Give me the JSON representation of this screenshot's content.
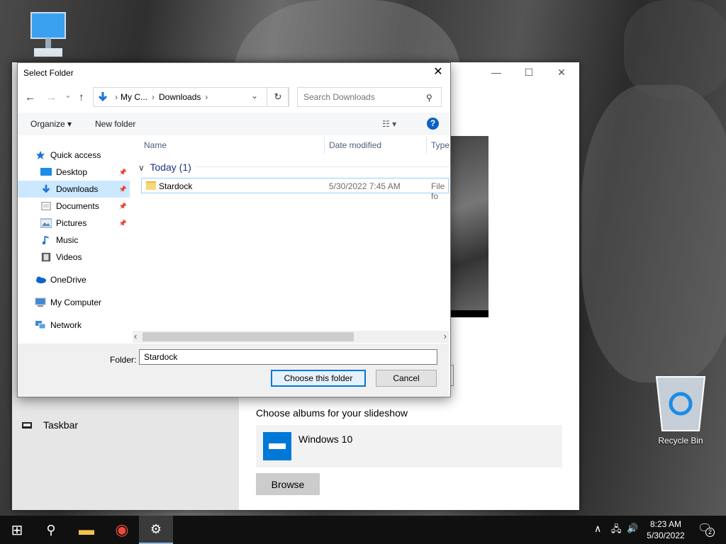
{
  "desktop": {
    "recycle_bin_label": "Recycle Bin"
  },
  "settings": {
    "minimize": "—",
    "maximize": "☐",
    "close": "✕",
    "taskbar_label": "Taskbar",
    "albums_heading": "Choose albums for your slideshow",
    "album_name": "Windows 10",
    "browse_label": "Browse"
  },
  "dialog": {
    "title": "Select Folder",
    "close": "✕",
    "back": "←",
    "forward": "→",
    "recent": "⌄",
    "up": "↑",
    "address": {
      "sep1": "›",
      "crumb1": "My C...",
      "sep2": "›",
      "crumb2": "Downloads",
      "sep3": "›",
      "dropdown": "⌄",
      "refresh": "↻"
    },
    "search_placeholder": "Search Downloads",
    "search_glyph": "⚲",
    "toolbar": {
      "organize": "Organize ▾",
      "new_folder": "New folder",
      "view": "☷ ▾",
      "help": "?"
    },
    "nav": [
      {
        "label": "Quick access",
        "icon": "star-icon",
        "color": "#1c73d6",
        "pinned": false
      },
      {
        "label": "Desktop",
        "icon": "desktop-icon",
        "color": "#1c8ce6",
        "pinned": true
      },
      {
        "label": "Downloads",
        "icon": "download-icon",
        "color": "#1c73d6",
        "pinned": true,
        "selected": true
      },
      {
        "label": "Documents",
        "icon": "document-icon",
        "color": "#7a7a7a",
        "pinned": true
      },
      {
        "label": "Pictures",
        "icon": "picture-icon",
        "color": "#5a89b8",
        "pinned": true
      },
      {
        "label": "Music",
        "icon": "music-icon",
        "color": "#1c73d6",
        "pinned": false
      },
      {
        "label": "Videos",
        "icon": "video-icon",
        "color": "#555",
        "pinned": false
      },
      {
        "label": "OneDrive",
        "icon": "cloud-icon",
        "color": "#0a64c9",
        "pinned": false
      },
      {
        "label": "My Computer",
        "icon": "computer-icon",
        "color": "#3a8ad6",
        "pinned": false
      },
      {
        "label": "Network",
        "icon": "network-icon",
        "color": "#3a8ad6",
        "pinned": false
      }
    ],
    "pin_glyph": "📌",
    "columns": {
      "name": "Name",
      "date": "Date modified",
      "type": "Type"
    },
    "group_label": "Today (1)",
    "group_chevron": "∨",
    "rows": [
      {
        "name": "Stardock",
        "date": "5/30/2022 7:45 AM",
        "type": "File fo"
      }
    ],
    "scroll_left": "‹",
    "scroll_right": "›",
    "folder_label": "Folder:",
    "folder_value": "Stardock",
    "choose_button": "Choose this folder",
    "cancel_button": "Cancel"
  },
  "taskbar": {
    "start": "⊞",
    "search": "⚲",
    "explorer": "▬",
    "chrome": "◉",
    "settings": "⚙",
    "tray_chevron": "∧",
    "network": "🖧",
    "volume": "🔊",
    "time": "8:23 AM",
    "date": "5/30/2022",
    "notifications": "🗨",
    "notification_count": "2"
  }
}
